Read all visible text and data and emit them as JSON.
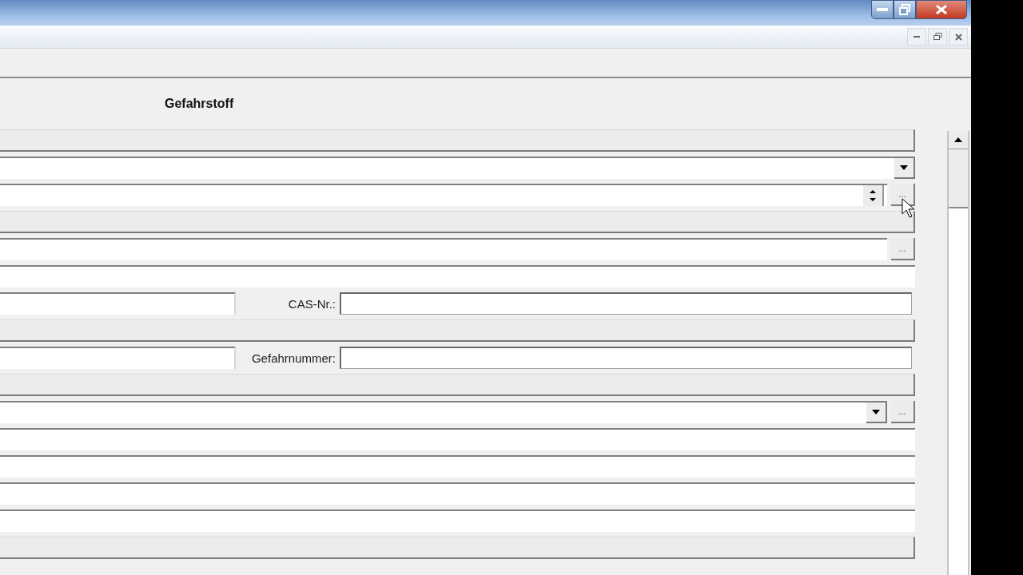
{
  "header": {
    "title": "Gefahrstoff"
  },
  "form_rows": [
    {
      "kind": "section"
    },
    {
      "kind": "dropdown"
    },
    {
      "kind": "spinner",
      "button": "..."
    },
    {
      "kind": "section"
    },
    {
      "kind": "text",
      "button": "..."
    },
    {
      "kind": "text"
    },
    {
      "kind": "split",
      "label": "CAS-Nr.:"
    },
    {
      "kind": "section"
    },
    {
      "kind": "split",
      "label": "Gefahrnummer:"
    },
    {
      "kind": "section"
    },
    {
      "kind": "dropdown",
      "button": "..."
    },
    {
      "kind": "text"
    },
    {
      "kind": "text"
    },
    {
      "kind": "text"
    },
    {
      "kind": "text"
    },
    {
      "kind": "section"
    }
  ]
}
